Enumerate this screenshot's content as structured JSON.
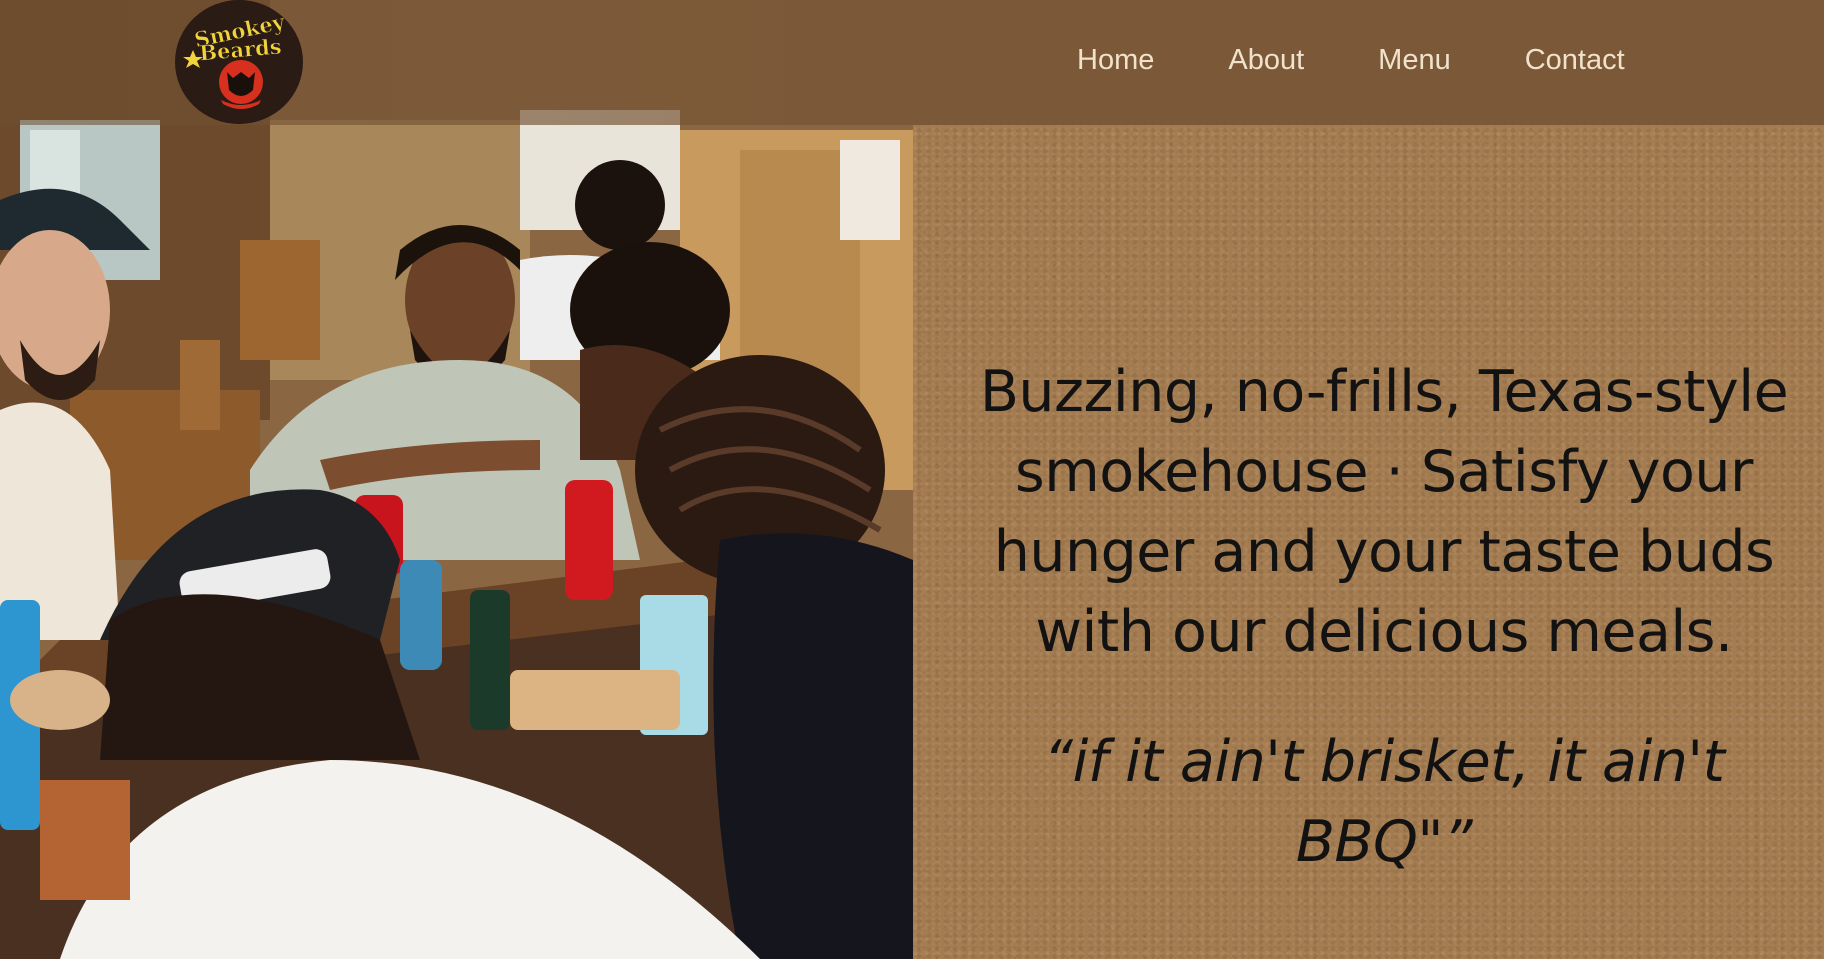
{
  "brand": {
    "logo_line1": "Smokey",
    "logo_line2": "Beards",
    "colors": {
      "logo_yellow": "#f0d43a",
      "logo_red": "#d8301e",
      "logo_dark": "#2a1b15",
      "header_brown": "#7a5838",
      "panel_tan": "#a57c50",
      "nav_text": "#f1e2cc"
    }
  },
  "nav": {
    "items": [
      {
        "label": "Home"
      },
      {
        "label": "About"
      },
      {
        "label": "Menu"
      },
      {
        "label": "Contact"
      }
    ]
  },
  "hero": {
    "description": "Buzzing, no-frills, Texas-style smokehouse · Satisfy your hunger and your taste buds with our delicious meals.",
    "quote": "“if it ain't brisket, it ain't BBQ\"”"
  },
  "photo": {
    "icon": "restaurant-diners-photo"
  }
}
